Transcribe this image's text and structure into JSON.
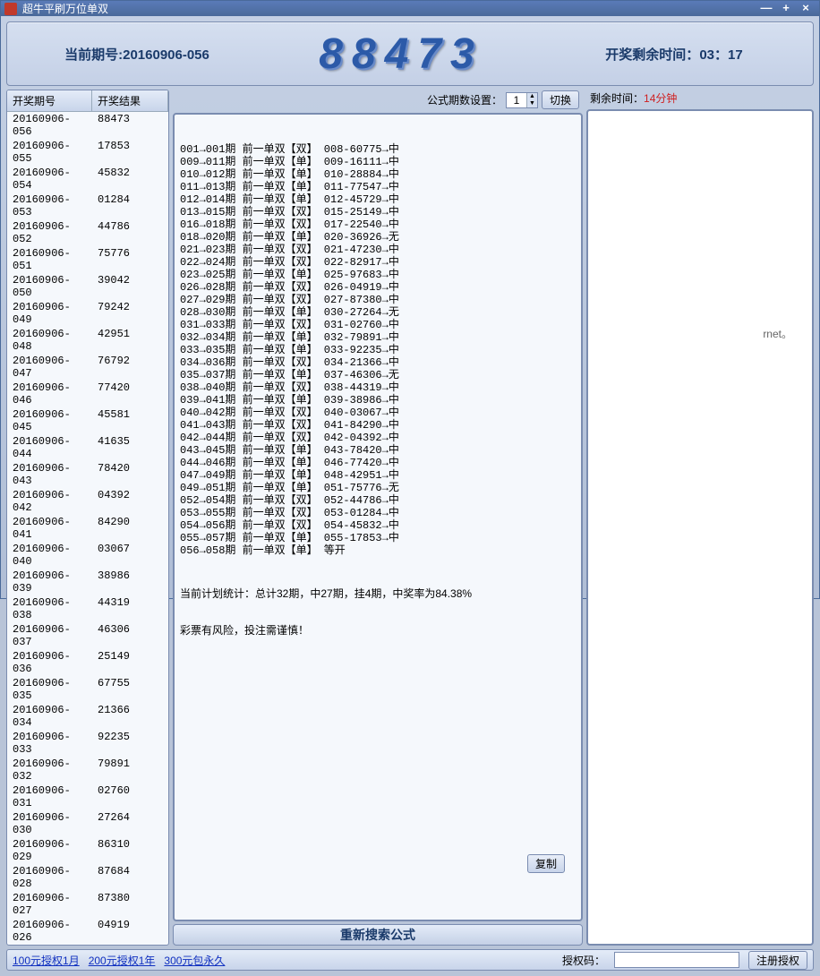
{
  "window": {
    "title": "超牛平刷万位单双"
  },
  "header": {
    "current_period_label": "当前期号:",
    "current_period": "20160906-056",
    "big_number": "88473",
    "countdown_label": "开奖剩余时间：",
    "countdown": "03：17"
  },
  "left_table": {
    "col1": "开奖期号",
    "col2": "开奖结果",
    "rows": [
      {
        "period": "20160906-056",
        "result": "88473"
      },
      {
        "period": "20160906-055",
        "result": "17853"
      },
      {
        "period": "20160906-054",
        "result": "45832"
      },
      {
        "period": "20160906-053",
        "result": "01284"
      },
      {
        "period": "20160906-052",
        "result": "44786"
      },
      {
        "period": "20160906-051",
        "result": "75776"
      },
      {
        "period": "20160906-050",
        "result": "39042"
      },
      {
        "period": "20160906-049",
        "result": "79242"
      },
      {
        "period": "20160906-048",
        "result": "42951"
      },
      {
        "period": "20160906-047",
        "result": "76792"
      },
      {
        "period": "20160906-046",
        "result": "77420"
      },
      {
        "period": "20160906-045",
        "result": "45581"
      },
      {
        "period": "20160906-044",
        "result": "41635"
      },
      {
        "period": "20160906-043",
        "result": "78420"
      },
      {
        "period": "20160906-042",
        "result": "04392"
      },
      {
        "period": "20160906-041",
        "result": "84290"
      },
      {
        "period": "20160906-040",
        "result": "03067"
      },
      {
        "period": "20160906-039",
        "result": "38986"
      },
      {
        "period": "20160906-038",
        "result": "44319"
      },
      {
        "period": "20160906-037",
        "result": "46306"
      },
      {
        "period": "20160906-036",
        "result": "25149"
      },
      {
        "period": "20160906-035",
        "result": "67755"
      },
      {
        "period": "20160906-034",
        "result": "21366"
      },
      {
        "period": "20160906-033",
        "result": "92235"
      },
      {
        "period": "20160906-032",
        "result": "79891"
      },
      {
        "period": "20160906-031",
        "result": "02760"
      },
      {
        "period": "20160906-030",
        "result": "27264"
      },
      {
        "period": "20160906-029",
        "result": "86310"
      },
      {
        "period": "20160906-028",
        "result": "87684"
      },
      {
        "period": "20160906-027",
        "result": "87380"
      },
      {
        "period": "20160906-026",
        "result": "04919"
      }
    ]
  },
  "center": {
    "formula_label": "公式期数设置：",
    "formula_value": "1",
    "switch_btn": "切换",
    "copy_btn": "复制",
    "research_btn": "重新搜索公式",
    "lines": [
      "001→001期 前一单双【双】 008-60775→中",
      "009→011期 前一单双【单】 009-16111→中",
      "010→012期 前一单双【单】 010-28884→中",
      "011→013期 前一单双【单】 011-77547→中",
      "012→014期 前一单双【单】 012-45729→中",
      "013→015期 前一单双【双】 015-25149→中",
      "016→018期 前一单双【双】 017-22540→中",
      "018→020期 前一单双【单】 020-36926→无",
      "021→023期 前一单双【双】 021-47230→中",
      "022→024期 前一单双【双】 022-82917→中",
      "023→025期 前一单双【单】 025-97683→中",
      "026→028期 前一单双【双】 026-04919→中",
      "027→029期 前一单双【双】 027-87380→中",
      "028→030期 前一单双【单】 030-27264→无",
      "031→033期 前一单双【双】 031-02760→中",
      "032→034期 前一单双【单】 032-79891→中",
      "033→035期 前一单双【单】 033-92235→中",
      "034→036期 前一单双【双】 034-21366→中",
      "035→037期 前一单双【单】 037-46306→无",
      "038→040期 前一单双【双】 038-44319→中",
      "039→041期 前一单双【单】 039-38986→中",
      "040→042期 前一单双【双】 040-03067→中",
      "041→043期 前一单双【双】 041-84290→中",
      "042→044期 前一单双【双】 042-04392→中",
      "043→045期 前一单双【单】 043-78420→中",
      "044→046期 前一单双【单】 046-77420→中",
      "047→049期 前一单双【单】 048-42951→中",
      "049→051期 前一单双【单】 051-75776→无",
      "052→054期 前一单双【双】 052-44786→中",
      "053→055期 前一单双【双】 053-01284→中",
      "054→056期 前一单双【双】 054-45832→中",
      "055→057期 前一单双【单】 055-17853→中",
      "056→058期 前一单双【单】 等开"
    ],
    "stats1": "当前计划统计：总计32期，中27期，挂4期，中奖率为84.38%",
    "stats2": "彩票有风险，投注需谨慎！"
  },
  "right": {
    "remain_label": "剩余时间：",
    "remain_value": "14分钟",
    "hint": "rnet。"
  },
  "bottom": {
    "link1": "100元授权1月",
    "link2": "200元授权1年",
    "link3": "300元包永久",
    "auth_label": "授权码：",
    "auth_btn": "注册授权"
  }
}
